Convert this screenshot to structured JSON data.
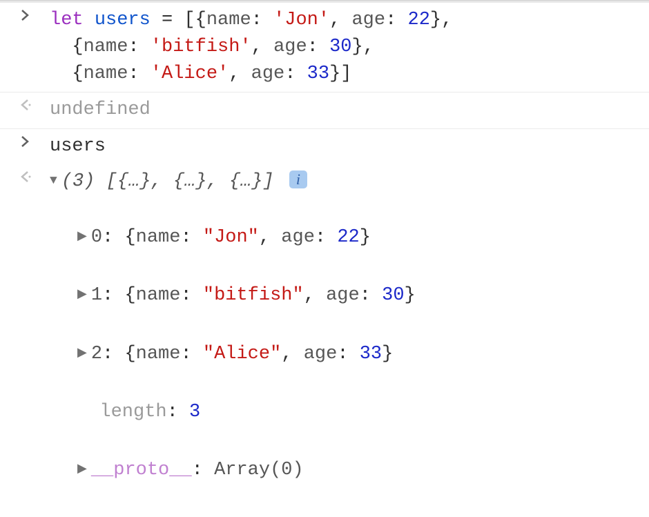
{
  "input1": {
    "kw": "let",
    "varname": "users",
    "assign": " = [{",
    "prop_name": "name",
    "sep1": ": ",
    "val_name0": "'Jon'",
    "sep2": ", ",
    "prop_age": "age",
    "sep3": ": ",
    "val_age0": "22",
    "close0": "},",
    "line2_open": "  {",
    "val_name1": "'bitfish'",
    "val_age1": "30",
    "close1": "},",
    "line3_open": "  {",
    "val_name2": "'Alice'",
    "val_age2": "33",
    "close2": "}]"
  },
  "output1": "undefined",
  "input2": "users",
  "output2": {
    "summary_count": "(3)",
    "summary_body": " [{…}, {…}, {…}] ",
    "info": "i",
    "items": [
      {
        "idx": "0",
        "name": "\"Jon\"",
        "age": "22"
      },
      {
        "idx": "1",
        "name": "\"bitfish\"",
        "age": "30"
      },
      {
        "idx": "2",
        "name": "\"Alice\"",
        "age": "33"
      }
    ],
    "length_label": "length",
    "length_val": "3",
    "proto_label": "__proto__",
    "proto_val": "Array(0)",
    "prop_name_label": "name",
    "prop_age_label": "age",
    "open_brace": "{",
    "close_brace": "}",
    "colon_sp": ": ",
    "comma_sp": ", "
  }
}
